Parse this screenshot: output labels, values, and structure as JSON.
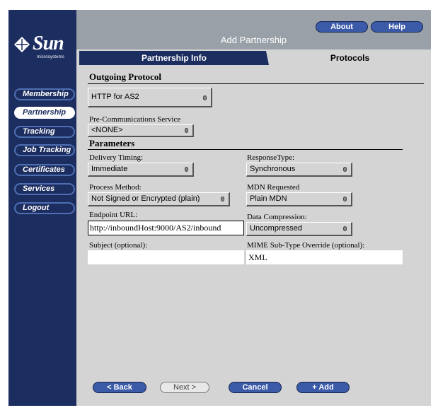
{
  "window": {
    "title": "Add Partnership"
  },
  "header_buttons": {
    "about": "About",
    "help": "Help"
  },
  "logo": {
    "brand": "Sun",
    "sub": "microsystems"
  },
  "sidebar": {
    "items": [
      {
        "label": "Membership"
      },
      {
        "label": "Partnership",
        "active": true
      },
      {
        "label": "Tracking"
      },
      {
        "label": "Job Tracking"
      },
      {
        "label": "Certificates"
      },
      {
        "label": "Services"
      },
      {
        "label": "Logout"
      }
    ]
  },
  "tabs": [
    {
      "label": "Partnership Info",
      "active": false
    },
    {
      "label": "Protocols",
      "active": true
    }
  ],
  "outgoing": {
    "heading": "Outgoing Protocol",
    "protocol_value": "HTTP for AS2",
    "precomm_label": "Pre-Communications Service",
    "precomm_value": "<NONE>"
  },
  "parameters": {
    "heading": "Parameters",
    "delivery_timing_label": "Delivery Timing:",
    "delivery_timing_value": "Immediate",
    "response_type_label": "ResponseType:",
    "response_type_value": "Synchronous",
    "process_method_label": "Process Method:",
    "process_method_value": "Not Signed or Encrypted (plain)",
    "mdn_requested_label": "MDN Requested",
    "mdn_requested_value": "Plain MDN",
    "endpoint_url_label": "Endpoint URL:",
    "endpoint_url_value": "http://inboundHost:9000/AS2/inbound",
    "data_compression_label": "Data Compression:",
    "data_compression_value": "Uncompressed",
    "subject_label": "Subject (optional):",
    "subject_value": "",
    "mime_label": "MIME Sub-Type Override (optional):",
    "mime_value": "XML"
  },
  "footer": {
    "back": "< Back",
    "next": "Next >",
    "cancel": "Cancel",
    "add": "+ Add"
  }
}
